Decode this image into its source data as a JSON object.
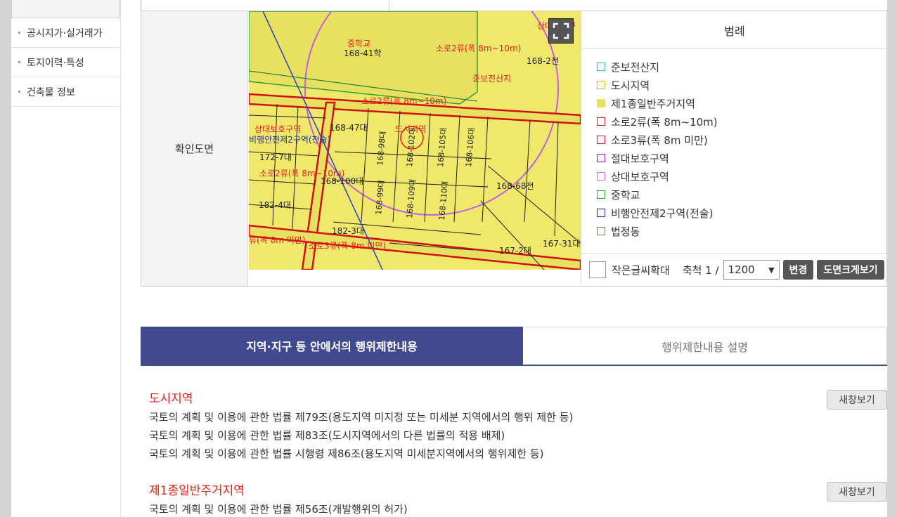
{
  "sidebar": {
    "items": [
      {
        "label": "공시지가·실거래가"
      },
      {
        "label": "토지이력·특성"
      },
      {
        "label": "건축물 정보"
      }
    ]
  },
  "confirm": {
    "label": "확인도면",
    "map_labels": [
      "중학교",
      "168-41학",
      "소로2류(폭 8m~10m)",
      "168-2전",
      "준보전산지",
      "소로2류(폭 8m~10m)",
      "상대보호구역",
      "비행안전제2구역(전술)",
      "168-47대",
      "도시지역",
      "172-7대",
      "소로2류(폭 8m~10m)",
      "168-100대",
      "168-68전",
      "182-4대",
      "182-3대",
      "류(폭 8m 미만)",
      "소로3류(폭 8m 미만)",
      "167-2대",
      "167-31대",
      "168-98대",
      "168-102대",
      "168-105대",
      "168-106대",
      "168-99대",
      "168-109대",
      "168-110대",
      "상대보호구"
    ]
  },
  "legend": {
    "title": "범례",
    "items": [
      {
        "label": "준보전산지",
        "color": "#3fb8a8",
        "fill": "#ffffff"
      },
      {
        "label": "도시지역",
        "color": "#d8c020",
        "fill": "#ffffff"
      },
      {
        "label": "제1종일반주거지역",
        "color": "#e8e060",
        "fill": "#e8e060"
      },
      {
        "label": "소로2류(폭 8m~10m)",
        "color": "#d02020",
        "fill": "#ffffff"
      },
      {
        "label": "소로3류(폭 8m 미만)",
        "color": "#d02020",
        "fill": "#ffffff"
      },
      {
        "label": "절대보호구역",
        "color": "#9020c0",
        "fill": "#ffffff"
      },
      {
        "label": "상대보호구역",
        "color": "#d070e0",
        "fill": "#ffffff"
      },
      {
        "label": "중학교",
        "color": "#30a030",
        "fill": "#ffffff"
      },
      {
        "label": "비행안전제2구역(전술)",
        "color": "#2030a0",
        "fill": "#ffffff"
      },
      {
        "label": "법정동",
        "color": "#8a7a50",
        "fill": "#ffffff"
      }
    ],
    "small_text_label": "작은글씨확대",
    "scale_label": "축척 1 /",
    "scale_value": "1200",
    "change_button": "변경",
    "bigmap_button": "도면크게보기"
  },
  "tabs": [
    {
      "label": "지역·지구 등 안에서의 행위제한내용"
    },
    {
      "label": "행위제한내용 설명"
    }
  ],
  "sections": [
    {
      "title": "도시지역",
      "button": "새창보기",
      "lines": [
        "국토의 계획 및 이용에 관한 법률 제79조(용도지역 미지정 또는 미세분 지역에서의 행위 제한 등)",
        "국토의 계획 및 이용에 관한 법률 제83조(도시지역에서의 다른 법률의 적용 배제)",
        "국토의 계획 및 이용에 관한 법률 시행령 제86조(용도지역 미세분지역에서의 행위제한 등)"
      ]
    },
    {
      "title": "제1종일반주거지역",
      "button": "새창보기",
      "lines": [
        "국토의 계획 및 이용에 관한 법률 제56조(개발행위의 허가)"
      ]
    }
  ]
}
